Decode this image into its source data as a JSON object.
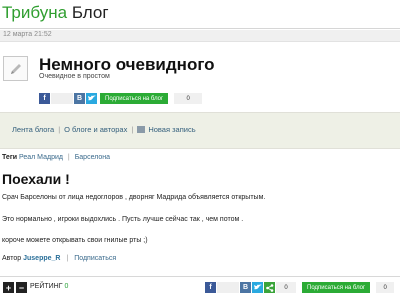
{
  "header": {
    "brand_part1": "Трибуна",
    "brand_part2": "Блог"
  },
  "date": "12 марта 21:52",
  "blog": {
    "title": "Немного очевидного",
    "subtitle": "Очевидное в простом",
    "subscribe_label": "Подписаться на блог",
    "subscribers": "0"
  },
  "nav": {
    "feed": "Лента блога",
    "about": "О блоге и авторах",
    "new_post": "Новая запись"
  },
  "tags": {
    "label": "Теги",
    "items": [
      "Реал Мадрид",
      "Барселона"
    ]
  },
  "post": {
    "title": "Поехали !",
    "paragraphs": [
      "Срач Барселоны от лица недоглоров , дворняг Мадрида объявляется открытым.",
      "Это нормально , игроки выдохлись . Пусть лучше сейчас так , чем потом .",
      "короче можете открывать свои гнилые рты ;)"
    ],
    "author_label": "Автор",
    "author": "Juseppe_R",
    "subscribe": "Подписаться"
  },
  "footer": {
    "rating_label": "РЕЙТИНГ",
    "rating_value": "0",
    "share_count": "0",
    "subscribe_label": "Подписаться на блог",
    "subscribers": "0"
  },
  "colors": {
    "brand_green": "#2f9e2f",
    "button_green": "#2bab35",
    "link_blue": "#3a6a8c",
    "nav_bg": "#eef0e6"
  }
}
